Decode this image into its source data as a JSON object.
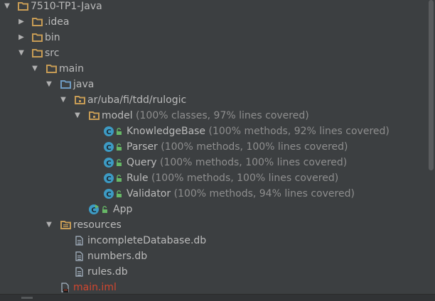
{
  "tree": [
    {
      "label": "7510-TP1-Java",
      "icon": "folder-icon",
      "expanded": true
    },
    {
      "label": ".idea",
      "icon": "folder-icon",
      "expanded": false
    },
    {
      "label": "bin",
      "icon": "folder-icon",
      "expanded": false
    },
    {
      "label": "src",
      "icon": "folder-icon",
      "expanded": true
    },
    {
      "label": "main",
      "icon": "folder-icon",
      "expanded": true
    },
    {
      "label": "java",
      "icon": "source-folder-icon",
      "expanded": true
    },
    {
      "label": "ar/uba/fi/tdd/rulogic",
      "icon": "package-folder-icon",
      "expanded": true
    },
    {
      "label": "model",
      "coverage": "(100% classes, 97% lines covered)",
      "icon": "package-folder-icon",
      "expanded": true
    },
    {
      "label": "KnowledgeBase",
      "coverage": "(100% methods, 92% lines covered)",
      "icon": "class-icon"
    },
    {
      "label": "Parser",
      "coverage": "(100% methods, 100% lines covered)",
      "icon": "class-icon"
    },
    {
      "label": "Query",
      "coverage": "(100% methods, 100% lines covered)",
      "icon": "class-icon"
    },
    {
      "label": "Rule",
      "coverage": "(100% methods, 100% lines covered)",
      "icon": "class-icon"
    },
    {
      "label": "Validator",
      "coverage": "(100% methods, 94% lines covered)",
      "icon": "class-icon"
    },
    {
      "label": "App",
      "icon": "runnable-class-icon"
    },
    {
      "label": "resources",
      "icon": "resources-folder-icon",
      "expanded": true
    },
    {
      "label": "incompleteDatabase.db",
      "icon": "file-icon"
    },
    {
      "label": "numbers.db",
      "icon": "file-icon"
    },
    {
      "label": "rules.db",
      "icon": "file-icon"
    },
    {
      "label": "main.iml",
      "icon": "iml-file-icon"
    }
  ],
  "colors": {
    "background": "#3c3f41",
    "text": "#bbbbbb",
    "coverage_text": "#8e8e8e",
    "folder": "#c79c55",
    "source_folder": "#6f9bc2",
    "class_badge": "#3d9bc4",
    "modified_file_text": "#d2462f"
  },
  "glyphs": {
    "expanded": "▼",
    "collapsed": "▶"
  }
}
